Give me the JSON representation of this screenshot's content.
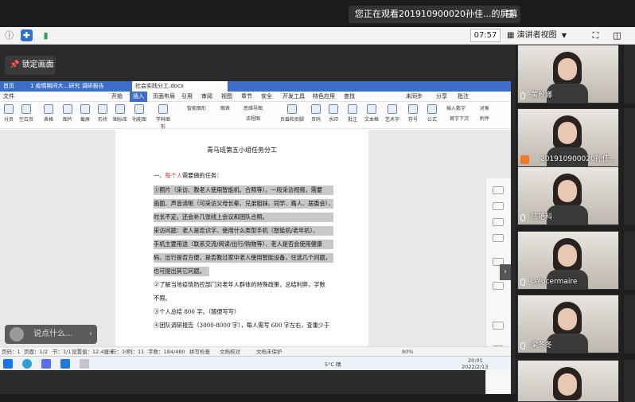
{
  "banner": {
    "sharing_text": "您正在观看201910900020孙佳...的屏幕",
    "menu_icon": "hamburger-icon"
  },
  "meeting_bar": {
    "clock": "07:57",
    "view_label": "演讲者视图"
  },
  "shared": {
    "lock_label": "锁定画面"
  },
  "app": {
    "tabs": [
      "首页",
      "1 疫情期间大...研究 调研报告",
      "社会实践分工.docx"
    ],
    "menus": [
      "文件",
      "开始",
      "插入",
      "页面布局",
      "引用",
      "审阅",
      "视图",
      "章节",
      "安全",
      "开发工具",
      "特色应用",
      "查找"
    ],
    "right_menus": [
      "未同步",
      "分享",
      "批注"
    ],
    "ribbon": [
      "分页",
      "空白页",
      "表格",
      "图片",
      "截屏",
      "形状",
      "图标库",
      "功能图",
      "学科图形",
      "智能图形",
      "图表",
      "思维导图",
      "流程图",
      "页眉和页脚",
      "页码",
      "水印",
      "批注",
      "文本框",
      "艺术字",
      "符号",
      "公式",
      "插入数字",
      "对象",
      "首字下沉",
      "附件"
    ],
    "doc": {
      "title": "青马班第五小组任务分工",
      "section1_prefix": "一、",
      "section1_red": "每个人",
      "section1_suffix": "需要做的任务：",
      "lines": [
        "①照片（采访、教老人使用智能机、合照等）。一段采访视频，需要",
        "画面、声音清晰（可采访父母长辈、兄弟姐妹、同学、路人、居委会），",
        "时长不定。还会补几张线上会议和团队合照。",
        "采访问题：老人是否识字、使用什么类型手机（智能机/老年机）、",
        "手机主要用途（联系交流/阅读/出行/购物等）、老人是否会使用健康",
        "码、出行是否方便，是否教过家中老人使用智能设备，住选几个问题，",
        "也可提出其它问题。",
        "②了解当地疫情防控部门对老年人群体的特殊政策，总结利弊，字数",
        "不限。",
        "③个人总结 800 字。（随便写写）",
        "④团队调研报告（3000-8000 字），每人需写 600 字左右，查重少于"
      ]
    },
    "status": [
      "页码：1",
      "页面：1/2",
      "节：1/1",
      "设置值：12.4厘米",
      "行：10",
      "列：11",
      "字数：184/480",
      "拼写检查",
      "文档校对",
      "文档未保护",
      "80%"
    ],
    "taskbar": {
      "weather": "5°C 晴",
      "time": "20:01",
      "date": "2022/2/13"
    },
    "say_box": "说点什么..."
  },
  "participants": [
    "黄秋娜",
    "201910900020孙佳...",
    "陆艳科",
    "Lelucermaire",
    "梁冬冬",
    ""
  ]
}
